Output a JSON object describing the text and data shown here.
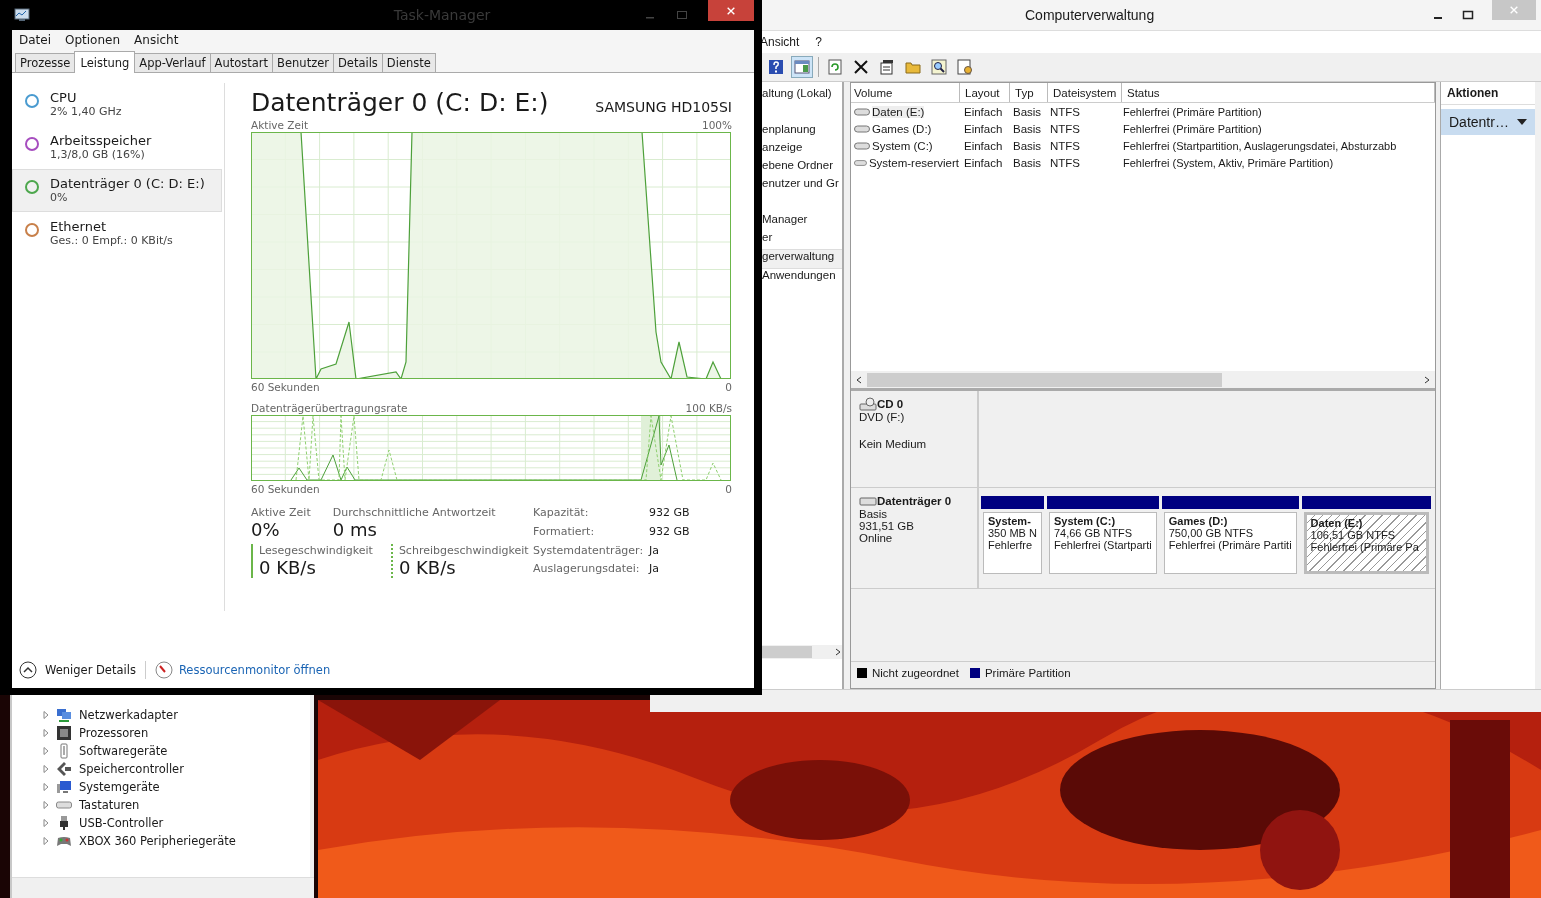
{
  "task_manager": {
    "title": "Task-Manager",
    "menu": [
      "Datei",
      "Optionen",
      "Ansicht"
    ],
    "tabs": [
      {
        "label": "Prozesse",
        "selected": false
      },
      {
        "label": "Leistung",
        "selected": true
      },
      {
        "label": "App-Verlauf",
        "selected": false
      },
      {
        "label": "Autostart",
        "selected": false
      },
      {
        "label": "Benutzer",
        "selected": false
      },
      {
        "label": "Details",
        "selected": false
      },
      {
        "label": "Dienste",
        "selected": false
      }
    ],
    "resources": [
      {
        "name": "CPU",
        "detail": "2%  1,40 GHz",
        "color": "#4a9bd0",
        "selected": false
      },
      {
        "name": "Arbeitsspeicher",
        "detail": "1,3/8,0 GB (16%)",
        "color": "#a64dbf",
        "selected": false
      },
      {
        "name": "Datenträger 0 (C: D: E:)",
        "detail": "0%",
        "color": "#4da74d",
        "selected": true
      },
      {
        "name": "Ethernet",
        "detail": "Ges.: 0 Empf.: 0 KBit/s",
        "color": "#c8804a",
        "selected": false
      }
    ],
    "disk": {
      "title": "Datenträger 0 (C: D: E:)",
      "model": "SAMSUNG HD105SI",
      "graphs": [
        {
          "label": "Aktive Zeit",
          "max": "100%",
          "time": "60 Sekunden",
          "min": "0"
        },
        {
          "label": "Datenträgerübertragungsrate",
          "max": "100 KB/s",
          "time": "60 Sekunden",
          "min": "0"
        }
      ],
      "stats": [
        {
          "label": "Aktive Zeit",
          "value": "0%"
        },
        {
          "label": "Durchschnittliche Antwortzeit",
          "value": "0 ms"
        }
      ],
      "speeds": [
        {
          "label": "Lesegeschwindigkeit",
          "value": "0 KB/s",
          "kind": "read"
        },
        {
          "label": "Schreibgeschwindigkeit",
          "value": "0 KB/s",
          "kind": "write"
        }
      ],
      "properties": [
        {
          "label": "Kapazität:",
          "value": "932 GB"
        },
        {
          "label": "Formatiert:",
          "value": "932 GB"
        },
        {
          "label": "Systemdatenträger:",
          "value": "Ja"
        },
        {
          "label": "Auslagerungsdatei:",
          "value": "Ja"
        }
      ]
    },
    "footer": {
      "less_details": "Weniger Details",
      "monitor_link": "Ressourcenmonitor öffnen"
    }
  },
  "computer_management": {
    "title": "Computerverwaltung",
    "menu": [
      "Ansicht",
      "?"
    ],
    "tree": [
      {
        "label": "altung (Lokal)",
        "selected": false
      },
      {
        "label": "enplanung",
        "selected": false
      },
      {
        "label": "anzeige",
        "selected": false
      },
      {
        "label": "ebene Ordner",
        "selected": false
      },
      {
        "label": "enutzer und Gr",
        "selected": false
      },
      {
        "label": "Manager",
        "selected": false
      },
      {
        "label": "er",
        "selected": false
      },
      {
        "label": "gerverwaltung",
        "selected": true
      },
      {
        "label": "Anwendungen",
        "selected": false
      }
    ],
    "table": {
      "columns": [
        "Volume",
        "Layout",
        "Typ",
        "Dateisystem",
        "Status"
      ],
      "rows": [
        {
          "cells": [
            "Daten (E:)",
            "Einfach",
            "Basis",
            "NTFS",
            "Fehlerfrei (Primäre Partition)"
          ],
          "selected": true
        },
        {
          "cells": [
            "Games (D:)",
            "Einfach",
            "Basis",
            "NTFS",
            "Fehlerfrei (Primäre Partition)"
          ],
          "selected": false
        },
        {
          "cells": [
            "System (C:)",
            "Einfach",
            "Basis",
            "NTFS",
            "Fehlerfrei (Startpartition, Auslagerungsdatei, Absturzabb"
          ],
          "selected": false
        },
        {
          "cells": [
            "System-reserviert",
            "Einfach",
            "Basis",
            "NTFS",
            "Fehlerfrei (System, Aktiv, Primäre Partition)"
          ],
          "selected": false
        }
      ]
    },
    "actions": {
      "title": "Aktionen",
      "item": "Datentr…"
    },
    "disks": [
      {
        "kind": "cd",
        "name": "CD 0",
        "lines": [
          "DVD (F:)",
          "Kein Medium"
        ]
      },
      {
        "kind": "hdd",
        "name": "Datenträger 0",
        "lines": [
          "Basis",
          "931,51 GB",
          "Online"
        ],
        "partitions": [
          {
            "name": "System-",
            "size": "350 MB N",
            "status": "Fehlerfre",
            "selected": false
          },
          {
            "name": "System  (C:)",
            "size": "74,66 GB NTFS",
            "status": "Fehlerfrei (Startparti",
            "selected": false
          },
          {
            "name": "Games  (D:)",
            "size": "750,00 GB NTFS",
            "status": "Fehlerfrei (Primäre Partiti",
            "selected": false
          },
          {
            "name": "Daten  (E:)",
            "size": "106,51 GB NTFS",
            "status": "Fehlerfrei (Primäre Pa",
            "selected": true
          }
        ]
      }
    ],
    "legend": [
      {
        "label": "Nicht zugeordnet",
        "color": "#000000"
      },
      {
        "label": "Primäre Partition",
        "color": "#000080"
      }
    ]
  },
  "device_manager": {
    "items": [
      {
        "label": "Netzwerkadapter",
        "kind": "network"
      },
      {
        "label": "Prozessoren",
        "kind": "cpu"
      },
      {
        "label": "Softwaregeräte",
        "kind": "software"
      },
      {
        "label": "Speichercontroller",
        "kind": "storage"
      },
      {
        "label": "Systemgeräte",
        "kind": "system"
      },
      {
        "label": "Tastaturen",
        "kind": "keyboard"
      },
      {
        "label": "USB-Controller",
        "kind": "usb"
      },
      {
        "label": "XBOX 360 Peripheriegeräte",
        "kind": "gamepad"
      }
    ]
  }
}
